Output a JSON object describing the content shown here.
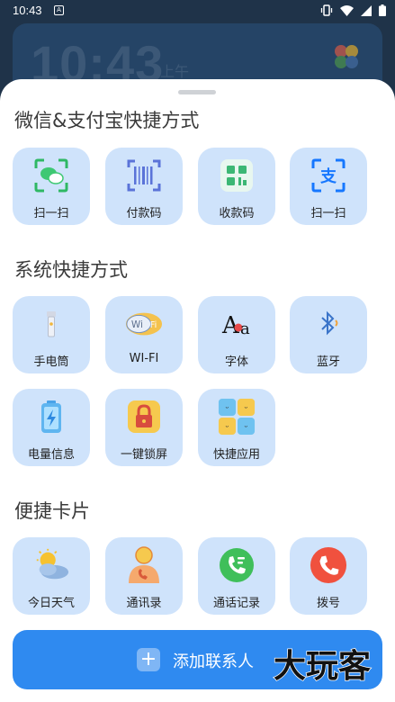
{
  "status": {
    "time": "10:43"
  },
  "background": {
    "clock": "10:43",
    "ampm": "上午"
  },
  "sections": [
    {
      "title": "微信&支付宝快捷方式"
    },
    {
      "title": "系统快捷方式"
    },
    {
      "title": "便捷卡片"
    }
  ],
  "wechat_alipay": [
    {
      "label": "扫一扫",
      "icon": "wechat-scan-icon"
    },
    {
      "label": "付款码",
      "icon": "barcode-icon"
    },
    {
      "label": "收款码",
      "icon": "qrcode-icon"
    },
    {
      "label": "扫一扫",
      "icon": "alipay-scan-icon"
    }
  ],
  "system": [
    {
      "label": "手电筒",
      "icon": "flashlight-icon"
    },
    {
      "label": "WI-FI",
      "icon": "wifi-icon"
    },
    {
      "label": "字体",
      "icon": "font-icon"
    },
    {
      "label": "蓝牙",
      "icon": "bluetooth-icon"
    },
    {
      "label": "电量信息",
      "icon": "battery-icon"
    },
    {
      "label": "一键锁屏",
      "icon": "lock-icon"
    },
    {
      "label": "快捷应用",
      "icon": "apps-icon"
    }
  ],
  "cards": [
    {
      "label": "今日天气",
      "icon": "weather-icon"
    },
    {
      "label": "通讯录",
      "icon": "contacts-icon"
    },
    {
      "label": "通话记录",
      "icon": "call-log-icon"
    },
    {
      "label": "拨号",
      "icon": "dialer-icon"
    }
  ],
  "add_button": {
    "label": "添加联系人"
  },
  "watermark": {
    "text": "大玩客"
  },
  "colors": {
    "tile": "#cfe3fb",
    "button": "#2f8af0",
    "sheet": "#ffffff"
  }
}
